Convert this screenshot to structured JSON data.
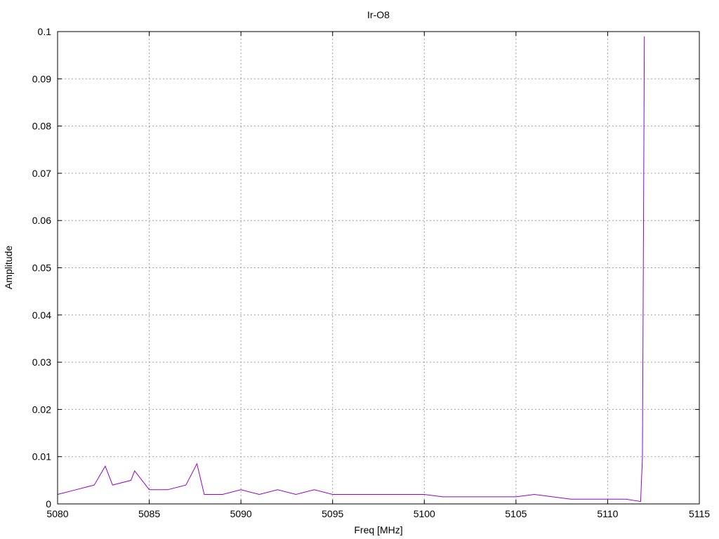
{
  "chart_data": {
    "type": "line",
    "title": "Ir-O8",
    "xlabel": "Freq [MHz]",
    "ylabel": "Amplitude",
    "xlim": [
      5080,
      5115
    ],
    "ylim": [
      0,
      0.1
    ],
    "x_ticks": [
      "5080",
      "5085",
      "5090",
      "5095",
      "5100",
      "5105",
      "5110",
      "5115"
    ],
    "y_ticks": [
      "0",
      "0.01",
      "0.02",
      "0.03",
      "0.04",
      "0.05",
      "0.06",
      "0.07",
      "0.08",
      "0.09",
      "0.1"
    ],
    "grid": true,
    "series_color": "#9400d3",
    "series": [
      {
        "x": [
          5080.0,
          5081.0,
          5082.0,
          5082.6,
          5083.0,
          5084.0,
          5084.2,
          5085.0,
          5086.0,
          5087.0,
          5087.6,
          5088.0,
          5089.0,
          5090.0,
          5091.0,
          5092.0,
          5093.0,
          5094.0,
          5095.0,
          5096.0,
          5097.0,
          5098.0,
          5099.0,
          5100.0,
          5101.0,
          5102.0,
          5103.0,
          5104.0,
          5105.0,
          5106.0,
          5107.0,
          5108.0,
          5109.0,
          5110.0,
          5111.0,
          5111.8,
          5111.9,
          5112.0
        ],
        "y": [
          0.002,
          0.003,
          0.004,
          0.008,
          0.004,
          0.005,
          0.007,
          0.003,
          0.003,
          0.004,
          0.0085,
          0.002,
          0.002,
          0.003,
          0.002,
          0.003,
          0.002,
          0.003,
          0.002,
          0.002,
          0.002,
          0.002,
          0.002,
          0.002,
          0.0015,
          0.0015,
          0.0015,
          0.0015,
          0.0015,
          0.002,
          0.0015,
          0.001,
          0.001,
          0.001,
          0.001,
          0.0005,
          0.01,
          0.099
        ]
      }
    ]
  }
}
